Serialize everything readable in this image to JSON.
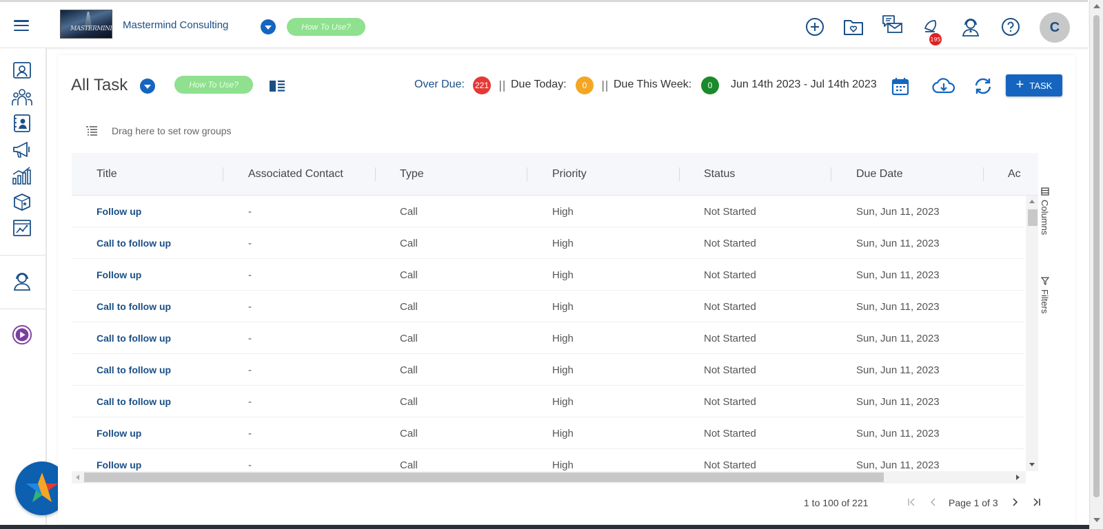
{
  "header": {
    "company_name": "Mastermind Consulting",
    "logo_text": "MASTERMIND",
    "how_to_use": "How To Use?",
    "notification_count": "195",
    "avatar_initial": "C",
    "icons": [
      "add-circle-icon",
      "heart-folder-icon",
      "chat-mail-icon",
      "bell-icon",
      "support-agent-icon",
      "help-icon"
    ]
  },
  "sidebar": {
    "items": [
      "contacts-icon",
      "team-icon",
      "contact-card-icon",
      "megaphone-icon",
      "bar-chart-icon",
      "box-star-icon",
      "analytics-icon",
      "support-agent-icon",
      "play-circle-icon"
    ]
  },
  "page": {
    "title": "All Task",
    "how_to_use": "How To Use?",
    "overdue_label": "Over Due:",
    "overdue_count": "221",
    "sep1": "||",
    "due_today_label": "Due Today:",
    "due_today_count": "0",
    "sep2": "||",
    "due_week_label": "Due This Week:",
    "due_week_count": "0",
    "date_range": "Jun 14th 2023 - Jul 14th 2023",
    "task_button": "TASK",
    "row_groups_hint": "Drag here to set row groups",
    "colors": {
      "overdue": "#e53935",
      "today": "#f5a623",
      "week": "#1b8a2a",
      "primary": "#1565c0"
    }
  },
  "grid": {
    "columns": [
      "Title",
      "Associated Contact",
      "Type",
      "Priority",
      "Status",
      "Due Date",
      "Ac"
    ],
    "rows": [
      [
        "Follow up",
        "-",
        "Call",
        "High",
        "Not Started",
        "Sun, Jun 11, 2023"
      ],
      [
        "Call to follow up",
        "-",
        "Call",
        "High",
        "Not Started",
        "Sun, Jun 11, 2023"
      ],
      [
        "Follow up",
        "-",
        "Call",
        "High",
        "Not Started",
        "Sun, Jun 11, 2023"
      ],
      [
        "Call to follow up",
        "-",
        "Call",
        "High",
        "Not Started",
        "Sun, Jun 11, 2023"
      ],
      [
        "Call to follow up",
        "-",
        "Call",
        "High",
        "Not Started",
        "Sun, Jun 11, 2023"
      ],
      [
        "Call to follow up",
        "-",
        "Call",
        "High",
        "Not Started",
        "Sun, Jun 11, 2023"
      ],
      [
        "Call to follow up",
        "-",
        "Call",
        "High",
        "Not Started",
        "Sun, Jun 11, 2023"
      ],
      [
        "Follow up",
        "-",
        "Call",
        "High",
        "Not Started",
        "Sun, Jun 11, 2023"
      ],
      [
        "Follow up",
        "-",
        "Call",
        "High",
        "Not Started",
        "Sun, Jun 11, 2023"
      ]
    ],
    "side_tabs": {
      "columns": "Columns",
      "filters": "Filters"
    }
  },
  "pager": {
    "summary": "1 to 100 of 221",
    "page_text": "Page 1 of 3"
  }
}
